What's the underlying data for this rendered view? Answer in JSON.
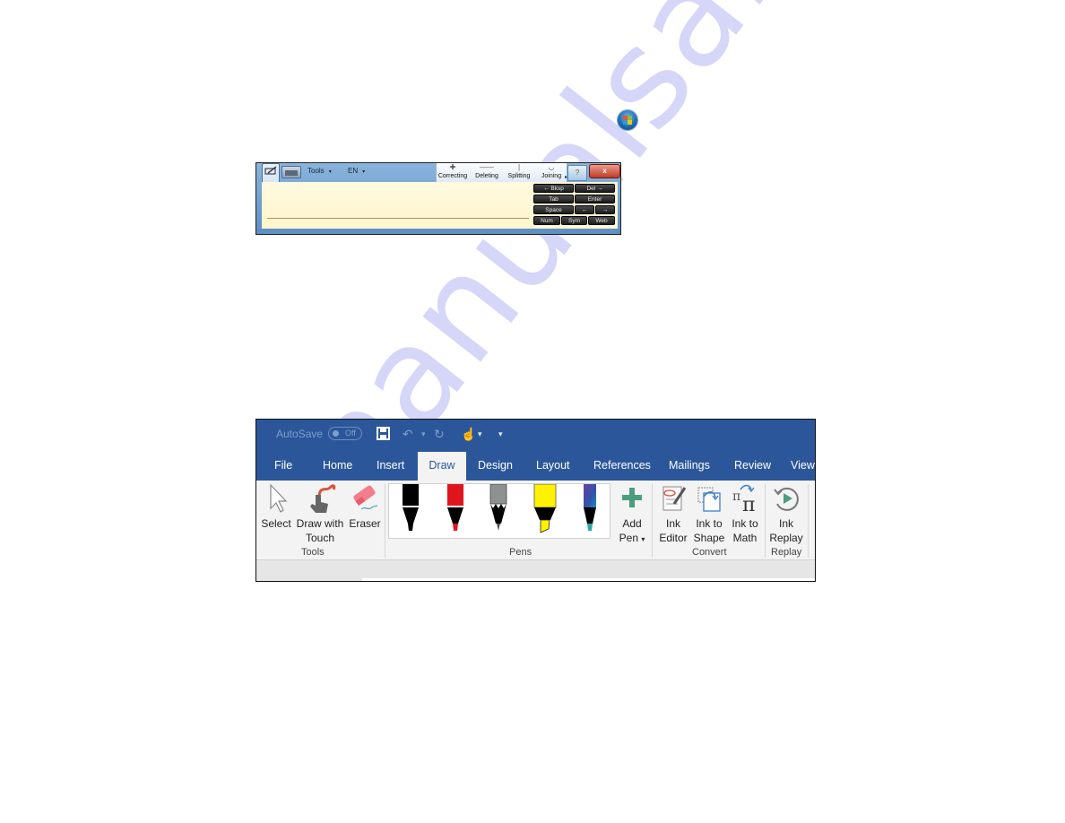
{
  "watermark": "manualsarchive.com",
  "start_button": {
    "icon": "windows-start-orb-icon"
  },
  "tip_panel": {
    "menus": [
      {
        "label": "Tools",
        "arrow": "▾"
      },
      {
        "label": "EN",
        "arrow": "▾"
      }
    ],
    "gestures": [
      {
        "label": "Correcting",
        "glyph": "✚"
      },
      {
        "label": "Deleting",
        "glyph": "——"
      },
      {
        "label": "Splitting",
        "glyph": "|"
      },
      {
        "label": "Joining",
        "glyph": "◡"
      }
    ],
    "help_glyph": "?",
    "close_glyph": "x",
    "expand_glyph": "▸",
    "keys": [
      {
        "label": "←  Bksp"
      },
      {
        "label": "Del  →"
      },
      {
        "label": "Tab"
      },
      {
        "label": "Enter"
      },
      {
        "label": "Space"
      },
      {
        "label": "←"
      },
      {
        "label": "→"
      },
      {
        "label": "Num"
      },
      {
        "label": "Sym"
      },
      {
        "label": "Web"
      }
    ]
  },
  "word": {
    "autosave": {
      "label": "AutoSave",
      "state": "Off"
    },
    "quick_access": {
      "save": "💾",
      "undo": "↶",
      "undo_dropdown": "▾",
      "redo": "↻",
      "touch": "☝",
      "touch_dropdown": "▾",
      "customize": "▾"
    },
    "tabs": [
      {
        "label": "File"
      },
      {
        "label": "Home"
      },
      {
        "label": "Insert"
      },
      {
        "label": "Draw",
        "active": true
      },
      {
        "label": "Design"
      },
      {
        "label": "Layout"
      },
      {
        "label": "References"
      },
      {
        "label": "Mailings"
      },
      {
        "label": "Review"
      },
      {
        "label": "View"
      }
    ],
    "groups": {
      "tools": {
        "label": "Tools",
        "buttons": [
          {
            "line1": "Select",
            "line2": ""
          },
          {
            "line1": "Draw with",
            "line2": "Touch"
          },
          {
            "line1": "Eraser",
            "line2": ""
          }
        ]
      },
      "pens": {
        "label": "Pens",
        "pens": [
          {
            "name": "Black pen",
            "color": "#000000"
          },
          {
            "name": "Red pen",
            "color": "#e0161f"
          },
          {
            "name": "Gray pencil",
            "color": "#8d9191"
          },
          {
            "name": "Yellow highlighter",
            "color": "#fff200"
          },
          {
            "name": "Galaxy pen",
            "color": "#4a4fa0"
          }
        ],
        "add_pen": {
          "line1": "Add",
          "line2": "Pen",
          "arrow": "▾"
        }
      },
      "convert": {
        "label": "Convert",
        "buttons": [
          {
            "line1": "Ink",
            "line2": "Editor"
          },
          {
            "line1": "Ink to",
            "line2": "Shape"
          },
          {
            "line1": "Ink to",
            "line2": "Math"
          }
        ]
      },
      "replay": {
        "label": "Replay",
        "buttons": [
          {
            "line1": "Ink",
            "line2": "Replay"
          }
        ]
      }
    },
    "colors": {
      "title_bar": "#2b579a",
      "ribbon": "#f3f3f3",
      "add_pen_accent": "#4c9c80"
    }
  }
}
